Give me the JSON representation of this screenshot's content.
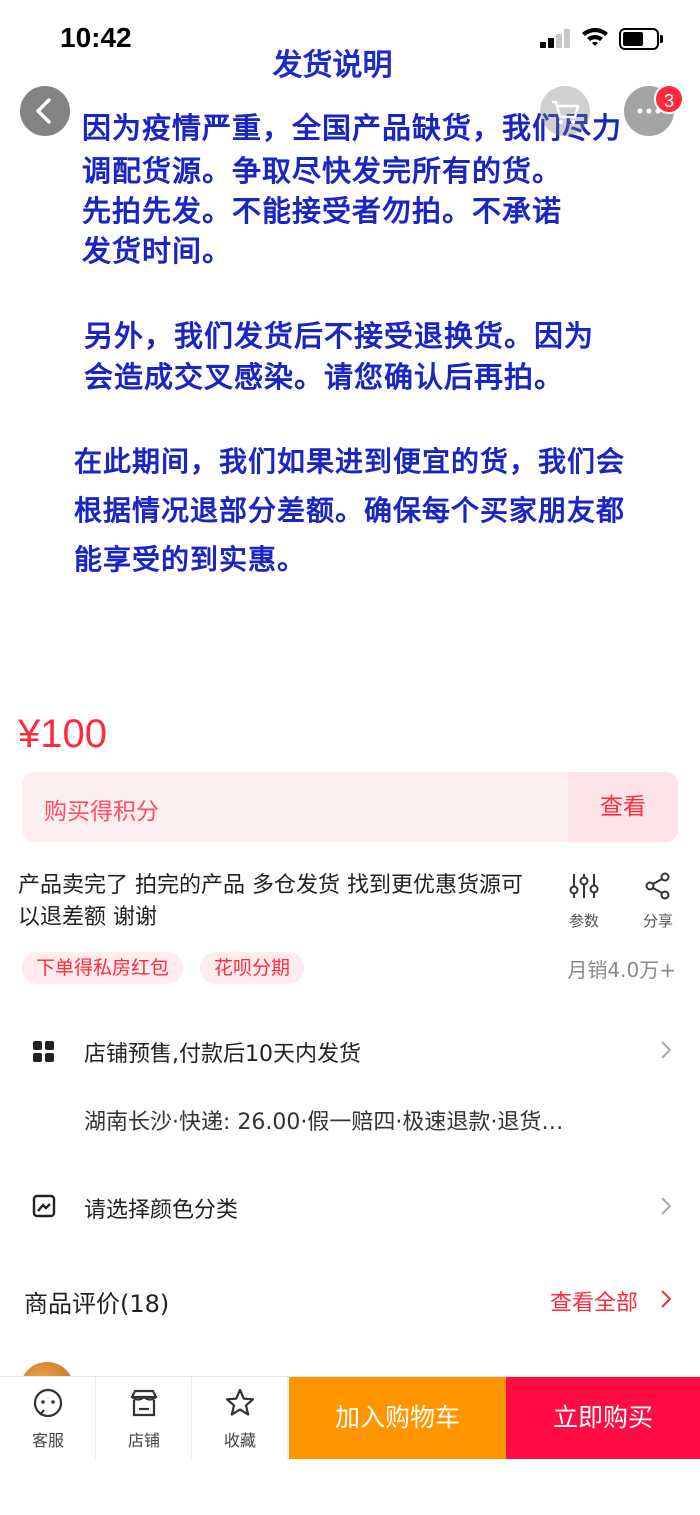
{
  "status_bar": {
    "time": "10:42"
  },
  "product_image": {
    "notice_title": "发货说明",
    "paragraphs": [
      [
        "因为疫情严重，全国产品缺货，我们尽力",
        "调配货源。争取尽快发完所有的货。",
        "先拍先发。不能接受者勿拍。不承诺",
        "发货时间。"
      ],
      [
        "另外，我们发货后不接受退换货。因为",
        "会造成交叉感染。请您确认后再拍。"
      ],
      [
        "在此期间，我们如果进到便宜的货，我们会",
        "根据情况退部分差额。确保每个买家朋友都",
        "能享受的到实惠。"
      ]
    ],
    "cart_badge": "3"
  },
  "price": "¥100",
  "points": {
    "label": "购买得积分",
    "button": "查看"
  },
  "title_text": "产品卖完了 拍完的产品 多仓发货 找到更优惠货源可以退差额 谢谢",
  "tools": {
    "params": "参数",
    "share": "分享"
  },
  "tags": [
    "下单得私房红包",
    "花呗分期"
  ],
  "monthly_sales": "月销4.0万+",
  "presale": "店铺预售,付款后10天内发货",
  "shipping": "湖南长沙·快递: 26.00·假一赔四·极速退款·退货…",
  "spec": "请选择颜色分类",
  "reviews": {
    "title": "商品评价(18)",
    "view_all": "查看全部"
  },
  "bottom_bar": {
    "service": "客服",
    "shop": "店铺",
    "favorite": "收藏",
    "add_to_cart": "加入购物车",
    "buy_now": "立即购买"
  },
  "colors": {
    "accent": "#ff2a3d",
    "orange": "#ff9600",
    "notice_blue": "#1b25c2"
  }
}
